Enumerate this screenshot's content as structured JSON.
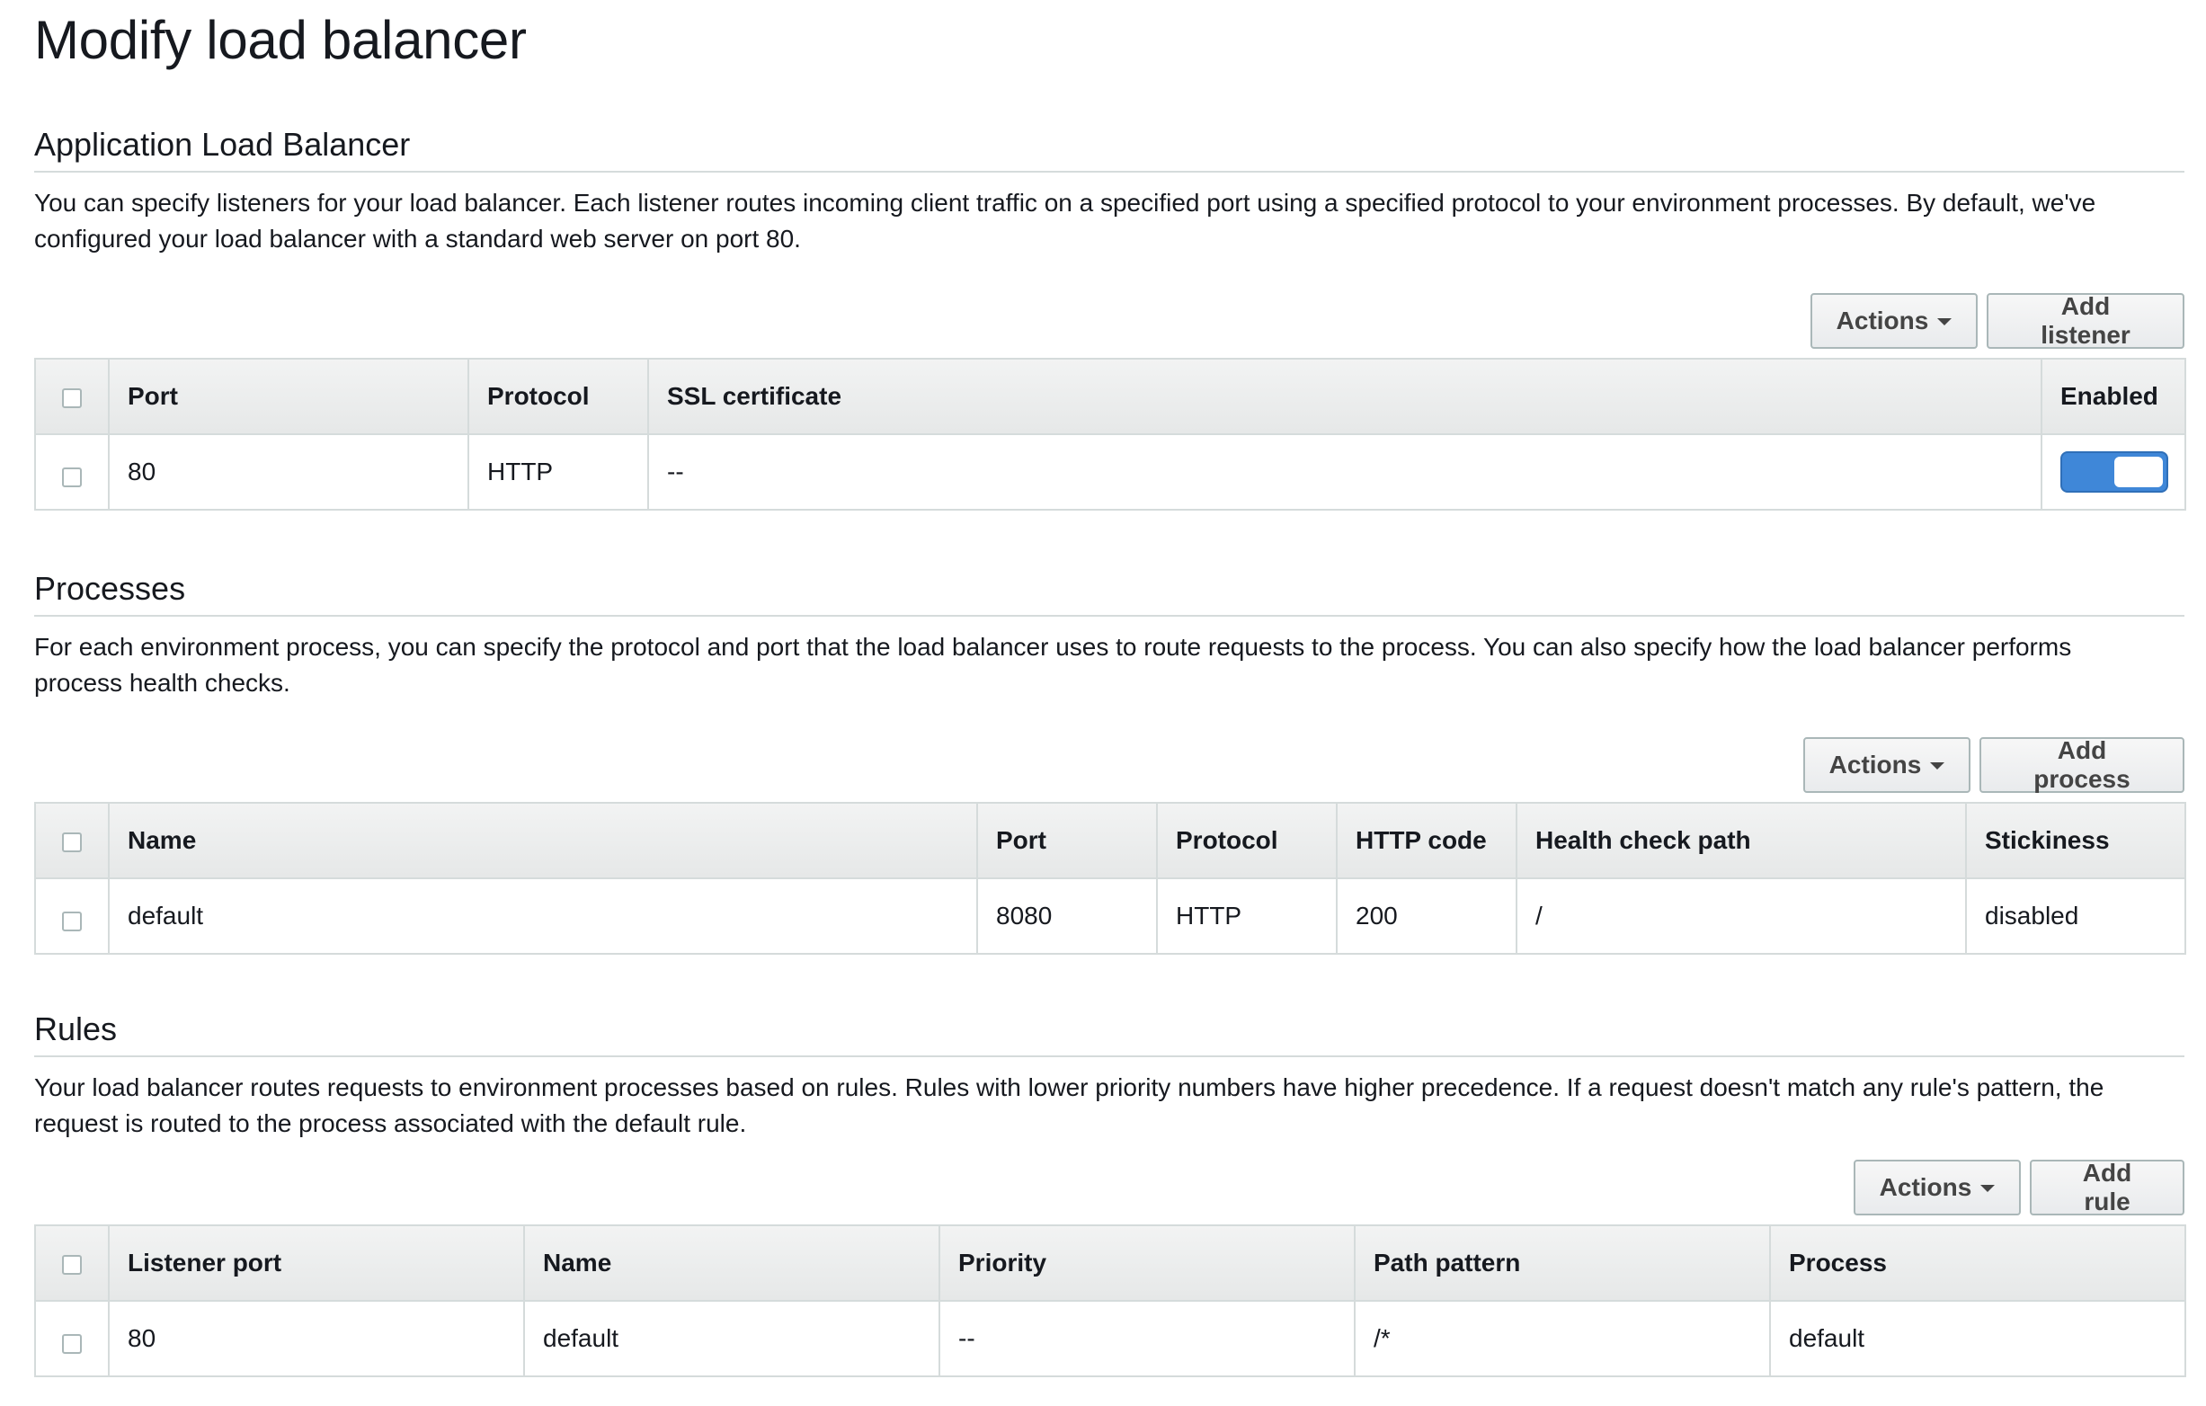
{
  "page": {
    "title": "Modify load balancer"
  },
  "alb": {
    "heading": "Application Load Balancer",
    "description": "You can specify listeners for your load balancer. Each listener routes incoming client traffic on a specified port using a specified protocol to your environment processes. By default, we've configured your load balancer with a standard web server on port 80.",
    "actions_label": "Actions",
    "add_label": "Add listener",
    "columns": [
      "Port",
      "Protocol",
      "SSL certificate",
      "Enabled"
    ],
    "rows": [
      {
        "port": "80",
        "protocol": "HTTP",
        "ssl_certificate": "--",
        "enabled": true
      }
    ]
  },
  "processes": {
    "heading": "Processes",
    "description": "For each environment process, you can specify the protocol and port that the load balancer uses to route requests to the process. You can also specify how the load balancer performs process health checks.",
    "actions_label": "Actions",
    "add_label": "Add process",
    "columns": [
      "Name",
      "Port",
      "Protocol",
      "HTTP code",
      "Health check path",
      "Stickiness"
    ],
    "rows": [
      {
        "name": "default",
        "port": "8080",
        "protocol": "HTTP",
        "http_code": "200",
        "health_check_path": "/",
        "stickiness": "disabled"
      }
    ]
  },
  "rules": {
    "heading": "Rules",
    "description": "Your load balancer routes requests to environment processes based on rules. Rules with lower priority numbers have higher precedence. If a request doesn't match any rule's pattern, the request is routed to the process associated with the default rule.",
    "actions_label": "Actions",
    "add_label": "Add rule",
    "columns": [
      "Listener port",
      "Name",
      "Priority",
      "Path pattern",
      "Process"
    ],
    "rows": [
      {
        "listener_port": "80",
        "name": "default",
        "priority": "--",
        "path_pattern": "/*",
        "process": "default"
      }
    ]
  },
  "colors": {
    "toggle_on": "#3f87d8",
    "border": "#d5dbdb",
    "header_bg": "#eaeded"
  }
}
